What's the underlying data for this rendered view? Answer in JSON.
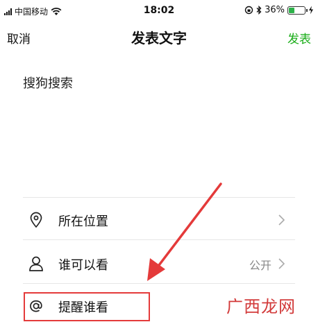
{
  "status_bar": {
    "carrier": "中国移动",
    "time": "18:02",
    "battery_percent": "36%",
    "battery_level": 0.36
  },
  "nav": {
    "cancel_label": "取消",
    "title": "发表文字",
    "publish_label": "发表",
    "publish_color": "#1aad19"
  },
  "post_text": "搜狗搜索",
  "options": [
    {
      "label": "所在位置",
      "icon": "location-pin-icon"
    },
    {
      "label": "谁可以看",
      "value": "公开",
      "icon": "person-icon"
    },
    {
      "label": "提醒谁看",
      "icon": "at-sign-icon"
    }
  ],
  "annotation": {
    "highlight_color": "#e43a3a",
    "arrow_color": "#e43a3a"
  },
  "watermark": {
    "text": "广西龙网"
  }
}
